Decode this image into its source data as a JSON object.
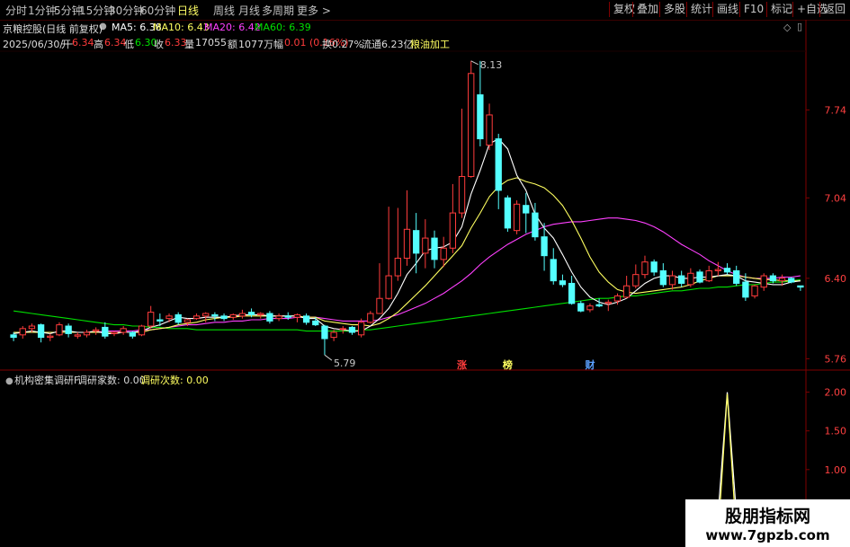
{
  "toolbar": {
    "tabs": [
      "分时",
      "1分钟",
      "5分钟",
      "15分钟",
      "30分钟",
      "60分钟",
      "日线",
      "周线",
      "月线",
      "多周期",
      "更多 >"
    ],
    "active_tab": "日线",
    "right_buttons": [
      "复权",
      "叠加",
      "多股",
      "统计",
      "画线",
      "F10",
      "标记",
      "+自选",
      "返回"
    ]
  },
  "info": {
    "stock_title": "京粮控股(日线 前复权)",
    "ma5": "MA5: 6.38",
    "ma10": "MA10: 6.43",
    "ma20": "MA20: 6.42",
    "ma60": "MA60: 6.39",
    "date": "2025/06/30/一",
    "open_label": "开",
    "open": "6.34",
    "high_label": "高",
    "high": "6.34",
    "low_label": "低",
    "low": "6.30",
    "close_label": "收",
    "close": "6.33",
    "vol_label": "量",
    "vol": "17055",
    "amount_label": "额",
    "amount": "1077万",
    "change_label": "幅",
    "change": "0.01 (0.16%)",
    "turnover": "换0.27%",
    "float_cap": "流通6.23亿",
    "industry": "粮油加工"
  },
  "colors": {
    "up": "#ff3c3c",
    "down": "#54ffff",
    "ma5": "#ffffff",
    "ma10": "#ffff60",
    "ma20": "#ff40ff",
    "ma60": "#00e000",
    "axis": "#800000",
    "indicator1": "#ffffff",
    "indicator2": "#ffff60"
  },
  "chart_data": [
    {
      "type": "candlestick",
      "title": "京粮控股(日线 前复权)",
      "y_ticks": [
        7.74,
        7.04,
        6.4,
        5.76
      ],
      "ylim": [
        5.72,
        8.2
      ],
      "high_annotation": "8.13",
      "low_annotation": "5.79",
      "markers": [
        {
          "index": 49,
          "text": "涨",
          "color": "#ff3c3c"
        },
        {
          "index": 54,
          "text": "榜",
          "color": "#ffff60"
        },
        {
          "index": 63,
          "text": "财",
          "color": "#5aa0ff"
        }
      ],
      "series_names": [
        "MA5",
        "MA10",
        "MA20",
        "MA60"
      ],
      "candles": [
        {
          "o": 5.95,
          "h": 5.97,
          "l": 5.9,
          "c": 5.93
        },
        {
          "o": 5.95,
          "h": 6.02,
          "l": 5.92,
          "c": 6.0
        },
        {
          "o": 6.0,
          "h": 6.04,
          "l": 5.97,
          "c": 6.02
        },
        {
          "o": 6.03,
          "h": 6.04,
          "l": 5.89,
          "c": 5.93
        },
        {
          "o": 5.93,
          "h": 5.96,
          "l": 5.9,
          "c": 5.94
        },
        {
          "o": 5.95,
          "h": 6.05,
          "l": 5.94,
          "c": 6.03
        },
        {
          "o": 6.02,
          "h": 6.04,
          "l": 5.93,
          "c": 5.96
        },
        {
          "o": 5.94,
          "h": 5.97,
          "l": 5.92,
          "c": 5.95
        },
        {
          "o": 5.95,
          "h": 5.99,
          "l": 5.93,
          "c": 5.97
        },
        {
          "o": 5.98,
          "h": 6.01,
          "l": 5.95,
          "c": 5.99
        },
        {
          "o": 6.01,
          "h": 6.05,
          "l": 5.92,
          "c": 5.94
        },
        {
          "o": 5.96,
          "h": 5.98,
          "l": 5.94,
          "c": 5.97
        },
        {
          "o": 5.97,
          "h": 6.02,
          "l": 5.95,
          "c": 6.0
        },
        {
          "o": 5.97,
          "h": 5.98,
          "l": 5.92,
          "c": 5.94
        },
        {
          "o": 5.95,
          "h": 6.03,
          "l": 5.94,
          "c": 6.02
        },
        {
          "o": 6.02,
          "h": 6.18,
          "l": 6.0,
          "c": 6.13
        },
        {
          "o": 6.07,
          "h": 6.12,
          "l": 6.02,
          "c": 6.06
        },
        {
          "o": 6.08,
          "h": 6.12,
          "l": 6.05,
          "c": 6.1
        },
        {
          "o": 6.11,
          "h": 6.13,
          "l": 6.03,
          "c": 6.05
        },
        {
          "o": 6.05,
          "h": 6.08,
          "l": 6.02,
          "c": 6.07
        },
        {
          "o": 6.08,
          "h": 6.12,
          "l": 6.07,
          "c": 6.1
        },
        {
          "o": 6.1,
          "h": 6.13,
          "l": 6.05,
          "c": 6.12
        },
        {
          "o": 6.11,
          "h": 6.13,
          "l": 6.06,
          "c": 6.1
        },
        {
          "o": 6.1,
          "h": 6.12,
          "l": 6.06,
          "c": 6.08
        },
        {
          "o": 6.09,
          "h": 6.12,
          "l": 6.07,
          "c": 6.11
        },
        {
          "o": 6.1,
          "h": 6.15,
          "l": 6.08,
          "c": 6.12
        },
        {
          "o": 6.13,
          "h": 6.16,
          "l": 6.09,
          "c": 6.11
        },
        {
          "o": 6.11,
          "h": 6.13,
          "l": 6.08,
          "c": 6.12
        },
        {
          "o": 6.12,
          "h": 6.14,
          "l": 6.04,
          "c": 6.06
        },
        {
          "o": 6.08,
          "h": 6.12,
          "l": 6.06,
          "c": 6.1
        },
        {
          "o": 6.1,
          "h": 6.13,
          "l": 6.07,
          "c": 6.09
        },
        {
          "o": 6.09,
          "h": 6.12,
          "l": 6.05,
          "c": 6.11
        },
        {
          "o": 6.1,
          "h": 6.12,
          "l": 6.03,
          "c": 6.05
        },
        {
          "o": 6.06,
          "h": 6.09,
          "l": 6.02,
          "c": 6.03
        },
        {
          "o": 6.02,
          "h": 6.03,
          "l": 5.79,
          "c": 5.92
        },
        {
          "o": 5.93,
          "h": 5.99,
          "l": 5.9,
          "c": 5.97
        },
        {
          "o": 6.0,
          "h": 6.02,
          "l": 5.96,
          "c": 6.0
        },
        {
          "o": 6.01,
          "h": 6.02,
          "l": 5.95,
          "c": 5.97
        },
        {
          "o": 5.95,
          "h": 6.08,
          "l": 5.93,
          "c": 6.05
        },
        {
          "o": 6.05,
          "h": 6.14,
          "l": 6.04,
          "c": 6.12
        },
        {
          "o": 6.12,
          "h": 6.52,
          "l": 6.12,
          "c": 6.24
        },
        {
          "o": 6.24,
          "h": 6.97,
          "l": 6.23,
          "c": 6.42
        },
        {
          "o": 6.42,
          "h": 6.96,
          "l": 6.38,
          "c": 6.56
        },
        {
          "o": 6.56,
          "h": 7.1,
          "l": 6.5,
          "c": 6.79
        },
        {
          "o": 6.78,
          "h": 6.92,
          "l": 6.44,
          "c": 6.6
        },
        {
          "o": 6.6,
          "h": 6.87,
          "l": 6.48,
          "c": 6.72
        },
        {
          "o": 6.72,
          "h": 6.78,
          "l": 6.48,
          "c": 6.55
        },
        {
          "o": 6.55,
          "h": 6.73,
          "l": 6.49,
          "c": 6.64
        },
        {
          "o": 6.64,
          "h": 7.15,
          "l": 6.6,
          "c": 6.92
        },
        {
          "o": 6.92,
          "h": 7.75,
          "l": 6.88,
          "c": 7.21
        },
        {
          "o": 7.21,
          "h": 8.13,
          "l": 7.2,
          "c": 8.03
        },
        {
          "o": 7.86,
          "h": 8.13,
          "l": 7.45,
          "c": 7.51
        },
        {
          "o": 7.46,
          "h": 7.79,
          "l": 7.42,
          "c": 7.7
        },
        {
          "o": 7.51,
          "h": 7.55,
          "l": 6.95,
          "c": 7.1
        },
        {
          "o": 7.04,
          "h": 7.06,
          "l": 6.77,
          "c": 6.8
        },
        {
          "o": 6.78,
          "h": 7.02,
          "l": 6.75,
          "c": 6.99
        },
        {
          "o": 6.98,
          "h": 7.08,
          "l": 6.76,
          "c": 6.92
        },
        {
          "o": 6.92,
          "h": 7.0,
          "l": 6.7,
          "c": 6.73
        },
        {
          "o": 6.73,
          "h": 6.84,
          "l": 6.46,
          "c": 6.58
        },
        {
          "o": 6.55,
          "h": 6.64,
          "l": 6.35,
          "c": 6.38
        },
        {
          "o": 6.38,
          "h": 6.43,
          "l": 6.33,
          "c": 6.35
        },
        {
          "o": 6.36,
          "h": 6.42,
          "l": 6.19,
          "c": 6.2
        },
        {
          "o": 6.2,
          "h": 6.22,
          "l": 6.13,
          "c": 6.14
        },
        {
          "o": 6.15,
          "h": 6.2,
          "l": 6.13,
          "c": 6.18
        },
        {
          "o": 6.19,
          "h": 6.24,
          "l": 6.17,
          "c": 6.18
        },
        {
          "o": 6.2,
          "h": 6.23,
          "l": 6.14,
          "c": 6.21
        },
        {
          "o": 6.22,
          "h": 6.28,
          "l": 6.19,
          "c": 6.26
        },
        {
          "o": 6.25,
          "h": 6.42,
          "l": 6.24,
          "c": 6.34
        },
        {
          "o": 6.34,
          "h": 6.51,
          "l": 6.32,
          "c": 6.43
        },
        {
          "o": 6.43,
          "h": 6.58,
          "l": 6.4,
          "c": 6.53
        },
        {
          "o": 6.53,
          "h": 6.55,
          "l": 6.42,
          "c": 6.45
        },
        {
          "o": 6.46,
          "h": 6.52,
          "l": 6.33,
          "c": 6.35
        },
        {
          "o": 6.35,
          "h": 6.46,
          "l": 6.31,
          "c": 6.42
        },
        {
          "o": 6.42,
          "h": 6.46,
          "l": 6.33,
          "c": 6.36
        },
        {
          "o": 6.35,
          "h": 6.48,
          "l": 6.33,
          "c": 6.44
        },
        {
          "o": 6.45,
          "h": 6.47,
          "l": 6.36,
          "c": 6.37
        },
        {
          "o": 6.38,
          "h": 6.5,
          "l": 6.37,
          "c": 6.46
        },
        {
          "o": 6.46,
          "h": 6.53,
          "l": 6.42,
          "c": 6.47
        },
        {
          "o": 6.48,
          "h": 6.52,
          "l": 6.43,
          "c": 6.45
        },
        {
          "o": 6.46,
          "h": 6.5,
          "l": 6.34,
          "c": 6.36
        },
        {
          "o": 6.37,
          "h": 6.44,
          "l": 6.22,
          "c": 6.25
        },
        {
          "o": 6.26,
          "h": 6.35,
          "l": 6.24,
          "c": 6.34
        },
        {
          "o": 6.33,
          "h": 6.44,
          "l": 6.3,
          "c": 6.42
        },
        {
          "o": 6.42,
          "h": 6.44,
          "l": 6.36,
          "c": 6.38
        },
        {
          "o": 6.38,
          "h": 6.43,
          "l": 6.34,
          "c": 6.4
        },
        {
          "o": 6.4,
          "h": 6.41,
          "l": 6.36,
          "c": 6.37
        },
        {
          "o": 6.34,
          "h": 6.34,
          "l": 6.3,
          "c": 6.33
        }
      ],
      "ma5": [
        5.96,
        5.97,
        5.98,
        5.97,
        5.96,
        5.98,
        5.98,
        5.97,
        5.97,
        5.98,
        5.96,
        5.96,
        5.97,
        5.97,
        5.98,
        6.01,
        6.03,
        6.06,
        6.09,
        6.08,
        6.08,
        6.09,
        6.09,
        6.09,
        6.1,
        6.11,
        6.11,
        6.11,
        6.1,
        6.1,
        6.1,
        6.1,
        6.08,
        6.08,
        6.02,
        6.0,
        5.99,
        5.98,
        5.98,
        6.02,
        6.08,
        6.16,
        6.28,
        6.43,
        6.52,
        6.62,
        6.64,
        6.65,
        6.69,
        6.81,
        7.07,
        7.26,
        7.47,
        7.51,
        7.43,
        7.22,
        7.1,
        6.91,
        6.8,
        6.72,
        6.59,
        6.45,
        6.33,
        6.25,
        6.21,
        6.19,
        6.21,
        6.24,
        6.3,
        6.36,
        6.4,
        6.42,
        6.42,
        6.4,
        6.4,
        6.41,
        6.41,
        6.42,
        6.43,
        6.42,
        6.38,
        6.37,
        6.36,
        6.35,
        6.35,
        6.37,
        6.38
      ],
      "ma10": [
        5.97,
        5.97,
        5.97,
        5.97,
        5.97,
        5.97,
        5.97,
        5.97,
        5.97,
        5.97,
        5.97,
        5.97,
        5.97,
        5.97,
        5.97,
        5.99,
        6.0,
        6.01,
        6.03,
        6.04,
        6.05,
        6.07,
        6.08,
        6.09,
        6.09,
        6.1,
        6.1,
        6.1,
        6.1,
        6.1,
        6.1,
        6.1,
        6.09,
        6.09,
        6.06,
        6.05,
        6.04,
        6.03,
        6.03,
        6.02,
        6.04,
        6.08,
        6.13,
        6.2,
        6.27,
        6.34,
        6.42,
        6.5,
        6.58,
        6.66,
        6.8,
        6.92,
        7.05,
        7.13,
        7.18,
        7.2,
        7.17,
        7.15,
        7.12,
        7.06,
        6.98,
        6.86,
        6.72,
        6.57,
        6.45,
        6.37,
        6.31,
        6.29,
        6.28,
        6.29,
        6.3,
        6.31,
        6.32,
        6.33,
        6.35,
        6.38,
        6.4,
        6.42,
        6.42,
        6.42,
        6.41,
        6.4,
        6.39,
        6.39,
        6.38,
        6.38,
        6.38
      ],
      "ma20": [
        5.97,
        5.97,
        5.97,
        5.97,
        5.97,
        5.97,
        5.97,
        5.97,
        5.97,
        5.97,
        5.98,
        5.98,
        5.98,
        5.98,
        5.99,
        5.99,
        6.0,
        6.01,
        6.02,
        6.03,
        6.03,
        6.04,
        6.05,
        6.05,
        6.06,
        6.06,
        6.07,
        6.07,
        6.08,
        6.08,
        6.08,
        6.09,
        6.09,
        6.09,
        6.08,
        6.07,
        6.06,
        6.06,
        6.06,
        6.06,
        6.07,
        6.09,
        6.11,
        6.14,
        6.17,
        6.2,
        6.24,
        6.28,
        6.33,
        6.38,
        6.44,
        6.51,
        6.57,
        6.62,
        6.67,
        6.71,
        6.75,
        6.78,
        6.81,
        6.83,
        6.84,
        6.85,
        6.85,
        6.86,
        6.87,
        6.88,
        6.88,
        6.87,
        6.86,
        6.84,
        6.81,
        6.77,
        6.72,
        6.67,
        6.63,
        6.59,
        6.54,
        6.5,
        6.46,
        6.43,
        6.41,
        6.4,
        6.4,
        6.4,
        6.41,
        6.41,
        6.42
      ],
      "ma60": [
        6.14,
        6.13,
        6.12,
        6.11,
        6.1,
        6.09,
        6.08,
        6.07,
        6.06,
        6.05,
        6.04,
        6.03,
        6.03,
        6.02,
        6.02,
        6.01,
        6.01,
        6.0,
        6.0,
        6.0,
        5.99,
        5.99,
        5.99,
        5.99,
        5.99,
        5.99,
        5.99,
        5.99,
        5.99,
        5.99,
        5.99,
        5.99,
        5.98,
        5.98,
        5.98,
        5.98,
        5.98,
        5.98,
        5.99,
        5.99,
        6.0,
        6.01,
        6.02,
        6.03,
        6.04,
        6.05,
        6.06,
        6.07,
        6.08,
        6.09,
        6.1,
        6.11,
        6.12,
        6.13,
        6.14,
        6.15,
        6.16,
        6.17,
        6.18,
        6.19,
        6.2,
        6.21,
        6.22,
        6.23,
        6.24,
        6.24,
        6.25,
        6.26,
        6.26,
        6.27,
        6.28,
        6.29,
        6.3,
        6.3,
        6.31,
        6.32,
        6.32,
        6.33,
        6.33,
        6.34,
        6.35,
        6.35,
        6.36,
        6.37,
        6.37,
        6.38,
        6.39
      ]
    },
    {
      "type": "line",
      "title": "机构密集调研F",
      "legend": [
        {
          "label": "调研家数:",
          "value": "0.00"
        },
        {
          "label": "调研次数:",
          "value": "0.00"
        }
      ],
      "y_ticks": [
        2.0,
        1.5,
        1.0
      ],
      "ylim": [
        0,
        2.1
      ],
      "spike_index": 78,
      "spike_value": 2.0
    }
  ],
  "watermark": {
    "line1": "股朋指标网",
    "line2": "www.7gpzb.com"
  }
}
